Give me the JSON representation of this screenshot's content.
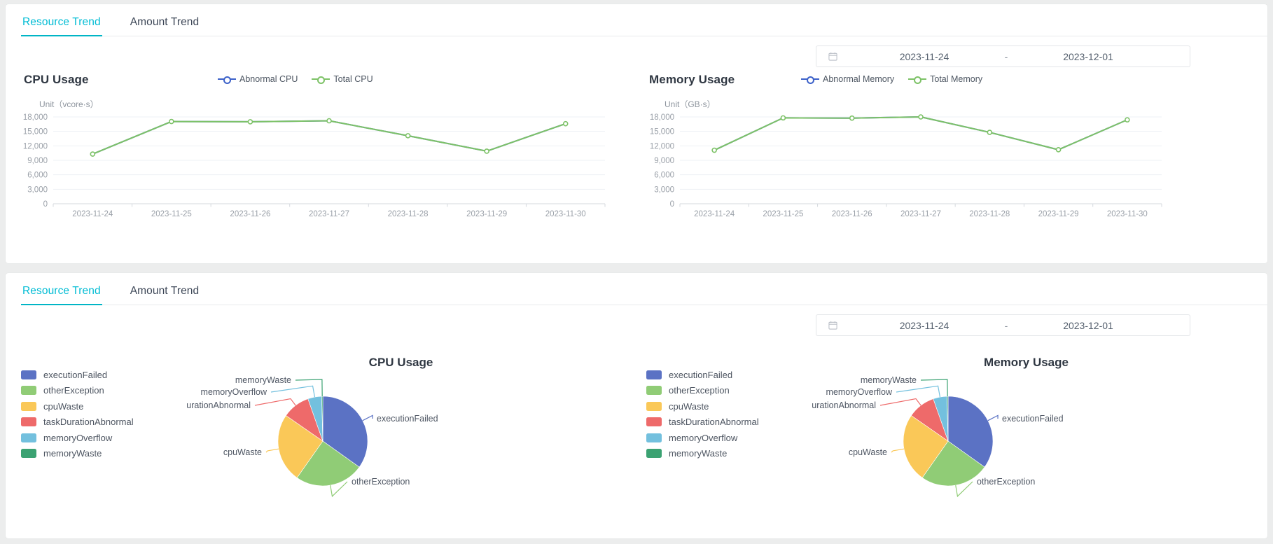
{
  "theme": {
    "accent": "#00b5c6",
    "page_bg": "#eceded",
    "panel_bg": "#ffffff",
    "text": "#3d4757"
  },
  "panels": [
    {
      "tabs": [
        {
          "label": "Resource Trend",
          "active": true
        },
        {
          "label": "Amount Trend",
          "active": false
        }
      ],
      "date_picker": {
        "icon": "calendar-icon",
        "start": "2023-11-24",
        "separator": "-",
        "end": "2023-12-01"
      }
    },
    {
      "tabs": [
        {
          "label": "Resource Trend",
          "active": true
        },
        {
          "label": "Amount Trend",
          "active": false
        }
      ],
      "date_picker": {
        "icon": "calendar-icon",
        "start": "2023-11-24",
        "separator": "-",
        "end": "2023-12-01"
      }
    }
  ],
  "pie_legend": [
    {
      "label": "executionFailed",
      "color": "#5b72c4"
    },
    {
      "label": "otherException",
      "color": "#90cc76"
    },
    {
      "label": "cpuWaste",
      "color": "#fac858"
    },
    {
      "label": "taskDurationAbnormal",
      "color": "#ee6a6a"
    },
    {
      "label": "memoryOverflow",
      "color": "#73c0de"
    },
    {
      "label": "memoryWaste",
      "color": "#3ba272"
    }
  ],
  "chart_data": [
    {
      "type": "line",
      "id": "cpu-usage-trend",
      "title": "CPU Usage",
      "unit_label": "Unit（vcore·s）",
      "xlabel": "",
      "ylabel": "",
      "ylim": [
        0,
        18000
      ],
      "yticks": [
        0,
        3000,
        6000,
        9000,
        12000,
        15000,
        18000
      ],
      "ytick_labels": [
        "0",
        "3,000",
        "6,000",
        "9,000",
        "12,000",
        "15,000",
        "18,000"
      ],
      "grid": true,
      "legend_position": "top-center",
      "categories": [
        "2023-11-24",
        "2023-11-25",
        "2023-11-26",
        "2023-11-27",
        "2023-11-28",
        "2023-11-29",
        "2023-11-30"
      ],
      "series": [
        {
          "name": "Abnormal CPU",
          "color": "#3c61c9",
          "values": [
            10300,
            17050,
            17000,
            17200,
            14100,
            10900,
            16600
          ]
        },
        {
          "name": "Total CPU",
          "color": "#7dc267",
          "values": [
            10300,
            17050,
            17000,
            17200,
            14100,
            10900,
            16600
          ]
        }
      ]
    },
    {
      "type": "line",
      "id": "memory-usage-trend",
      "title": "Memory Usage",
      "unit_label": "Unit（GB·s）",
      "xlabel": "",
      "ylabel": "",
      "ylim": [
        0,
        18000
      ],
      "yticks": [
        0,
        3000,
        6000,
        9000,
        12000,
        15000,
        18000
      ],
      "ytick_labels": [
        "0",
        "3,000",
        "6,000",
        "9,000",
        "12,000",
        "15,000",
        "18,000"
      ],
      "grid": true,
      "legend_position": "top-center",
      "categories": [
        "2023-11-24",
        "2023-11-25",
        "2023-11-26",
        "2023-11-27",
        "2023-11-28",
        "2023-11-29",
        "2023-11-30"
      ],
      "series": [
        {
          "name": "Abnormal Memory",
          "color": "#3c61c9",
          "values": [
            11100,
            17800,
            17750,
            18000,
            14800,
            11200,
            17400
          ]
        },
        {
          "name": "Total Memory",
          "color": "#7dc267",
          "values": [
            11100,
            17800,
            17750,
            18000,
            14800,
            11200,
            17400
          ]
        }
      ]
    },
    {
      "type": "pie",
      "id": "cpu-usage-pie",
      "title": "CPU Usage",
      "legend_position": "left",
      "categories": [
        "executionFailed",
        "otherException",
        "cpuWaste",
        "taskDurationAbnormal",
        "memoryOverflow",
        "memoryWaste"
      ],
      "values": [
        35,
        25,
        25,
        10,
        5,
        0.4
      ],
      "colors": [
        "#5b72c4",
        "#90cc76",
        "#fac858",
        "#ee6a6a",
        "#73c0de",
        "#3ba272"
      ]
    },
    {
      "type": "pie",
      "id": "memory-usage-pie",
      "title": "Memory Usage",
      "legend_position": "left",
      "categories": [
        "executionFailed",
        "otherException",
        "cpuWaste",
        "taskDurationAbnormal",
        "memoryOverflow",
        "memoryWaste"
      ],
      "values": [
        35,
        25,
        25,
        10,
        5,
        0.4
      ],
      "colors": [
        "#5b72c4",
        "#90cc76",
        "#fac858",
        "#ee6a6a",
        "#73c0de",
        "#3ba272"
      ]
    }
  ]
}
